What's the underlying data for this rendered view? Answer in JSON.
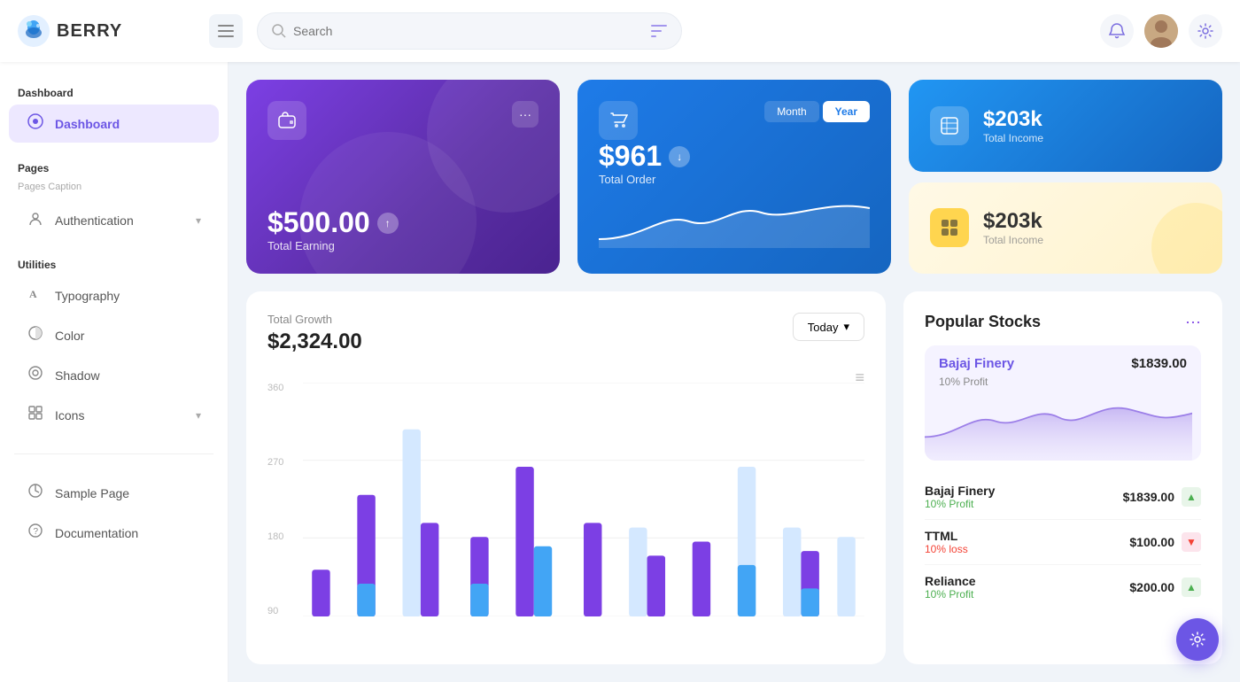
{
  "header": {
    "logo_text": "BERRY",
    "search_placeholder": "Search",
    "menu_icon": "☰",
    "notification_icon": "🔔",
    "settings_icon": "⚙"
  },
  "sidebar": {
    "dashboard_section": "Dashboard",
    "dashboard_item": "Dashboard",
    "pages_section": "Pages",
    "pages_caption": "Pages Caption",
    "authentication_item": "Authentication",
    "utilities_section": "Utilities",
    "typography_item": "Typography",
    "color_item": "Color",
    "shadow_item": "Shadow",
    "icons_item": "Icons",
    "sample_page_item": "Sample Page",
    "documentation_item": "Documentation"
  },
  "earning_card": {
    "amount": "$500.00",
    "label": "Total Earning",
    "menu_icon": "···",
    "arrow": "↑"
  },
  "order_card": {
    "amount": "$961",
    "label": "Total Order",
    "toggle_month": "Month",
    "toggle_year": "Year",
    "arrow": "↓"
  },
  "income_card_blue": {
    "amount": "$203k",
    "label": "Total Income"
  },
  "income_card_yellow": {
    "amount": "$203k",
    "label": "Total Income"
  },
  "growth_chart": {
    "title": "Total Growth",
    "amount": "$2,324.00",
    "today_btn": "Today",
    "y_labels": [
      "360",
      "270",
      "180",
      "90"
    ],
    "menu_icon": "≡"
  },
  "stocks": {
    "title": "Popular Stocks",
    "menu_icon": "···",
    "featured": {
      "name": "Bajaj Finery",
      "price": "$1839.00",
      "profit_label": "10% Profit"
    },
    "list": [
      {
        "name": "Bajaj Finery",
        "profit": "10% Profit",
        "profit_type": "green",
        "price": "$1839.00",
        "trend": "up"
      },
      {
        "name": "TTML",
        "profit": "10% loss",
        "profit_type": "red",
        "price": "$100.00",
        "trend": "down"
      },
      {
        "name": "Reliance",
        "profit": "10% Profit",
        "profit_type": "green",
        "price": "$200.00",
        "trend": "up"
      }
    ]
  },
  "fab": {
    "icon": "⚙"
  }
}
